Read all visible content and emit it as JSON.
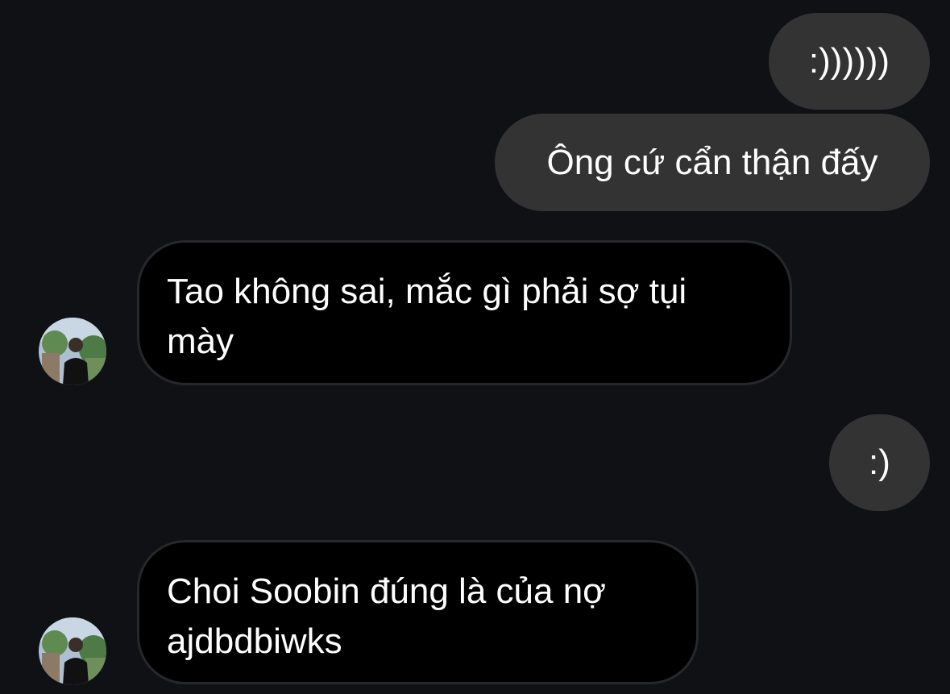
{
  "messages": [
    {
      "id": "m1",
      "direction": "sent",
      "text": ":))))))"
    },
    {
      "id": "m2",
      "direction": "sent",
      "text": "Ông cứ cẩn thận đấy"
    },
    {
      "id": "m3",
      "direction": "received",
      "lines": [
        "Tao không sai, mắc gì phải sợ tụi",
        "mày"
      ]
    },
    {
      "id": "m4",
      "direction": "sent",
      "text": ":)"
    },
    {
      "id": "m5",
      "direction": "received",
      "lines": [
        "Choi Soobin đúng là của nợ",
        "ajdbdbiwks"
      ]
    }
  ],
  "colors": {
    "background": "#0f1115",
    "sent_bubble": "#333333",
    "received_bubble": "#000000",
    "received_border": "#26282c",
    "text": "#ffffff"
  },
  "icons": {
    "avatar": "contact-avatar-photo"
  }
}
